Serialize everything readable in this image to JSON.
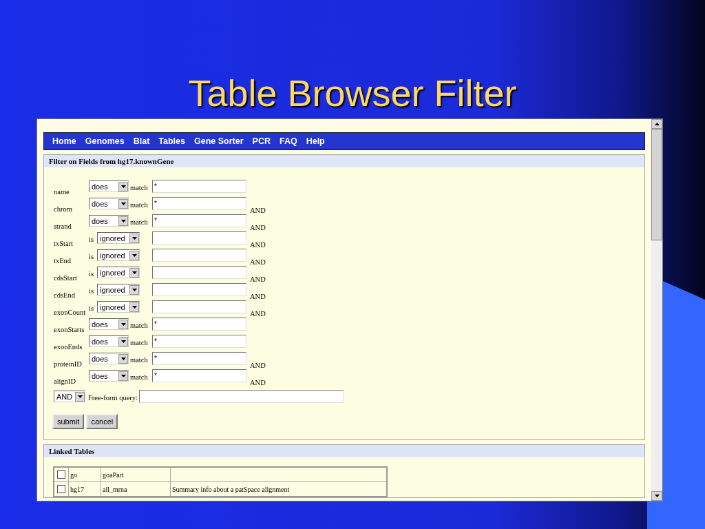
{
  "slide": {
    "title": "Table Browser Filter"
  },
  "nav": [
    "Home",
    "Genomes",
    "Blat",
    "Tables",
    "Gene Sorter",
    "PCR",
    "FAQ",
    "Help"
  ],
  "filter": {
    "heading": "Filter on Fields from hg17.knownGene",
    "rows": [
      {
        "kind": "match",
        "name": "name",
        "select": "does",
        "verb": "match",
        "value": "*"
      },
      {
        "kind": "match",
        "name": "chrom",
        "select": "does",
        "verb": "match",
        "value": "*",
        "conjunction": "AND"
      },
      {
        "kind": "match",
        "name": "strand",
        "select": "does",
        "verb": "match",
        "value": "*",
        "conjunction": "AND"
      },
      {
        "kind": "range",
        "name": "txStart",
        "verb": "is",
        "select": "ignored",
        "conjunction": "AND"
      },
      {
        "kind": "range",
        "name": "txEnd",
        "verb": "is",
        "select": "ignored",
        "conjunction": "AND"
      },
      {
        "kind": "range",
        "name": "cdsStart",
        "verb": "is",
        "select": "ignored",
        "conjunction": "AND"
      },
      {
        "kind": "range",
        "name": "cdsEnd",
        "verb": "is",
        "select": "ignored",
        "conjunction": "AND"
      },
      {
        "kind": "range",
        "name": "exonCount",
        "verb": "is",
        "select": "ignored",
        "conjunction": "AND"
      },
      {
        "kind": "match",
        "name": "exonStarts",
        "select": "does",
        "verb": "match",
        "value": "*"
      },
      {
        "kind": "match",
        "name": "exonEnds",
        "select": "does",
        "verb": "match",
        "value": "*"
      },
      {
        "kind": "match",
        "name": "proteinID",
        "select": "does",
        "verb": "match",
        "value": "*",
        "conjunction": "AND"
      },
      {
        "kind": "match",
        "name": "alignID",
        "select": "does",
        "verb": "match",
        "value": "*",
        "conjunction": "AND"
      }
    ],
    "logic": {
      "select": "AND",
      "label": "Free-form query:"
    },
    "buttons": [
      "submit",
      "cancel"
    ]
  },
  "linked": {
    "heading": "Linked Tables",
    "rows": [
      {
        "checked": false,
        "database": "go",
        "table": "goaPart"
      },
      {
        "checked": false,
        "database": "hg17",
        "table": "all_mrna",
        "description": "Summary info about a patSpace alignment"
      }
    ]
  }
}
